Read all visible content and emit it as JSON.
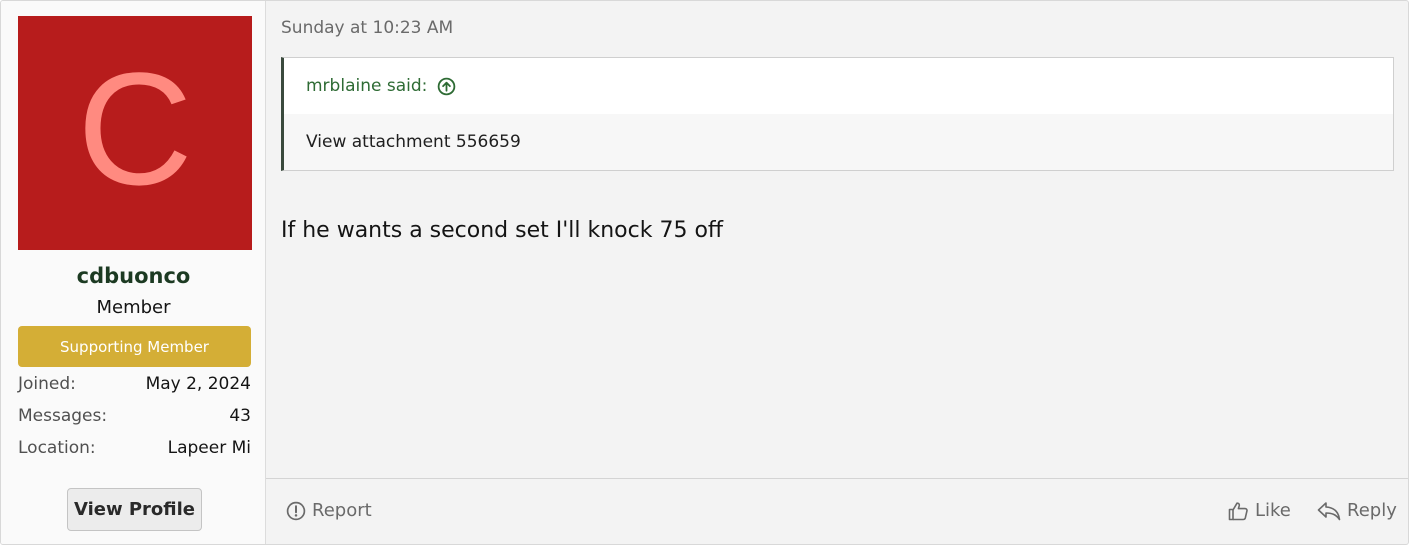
{
  "user": {
    "avatar_letter": "C",
    "avatar_bg": "#b71c1c",
    "avatar_fg": "#ff8a80",
    "name": "cdbuonco",
    "title": "Member",
    "banner": "Supporting Member",
    "banner_color": "#d4ae36",
    "stats": [
      {
        "label": "Joined:",
        "value": "May 2, 2024"
      },
      {
        "label": "Messages:",
        "value": "43"
      },
      {
        "label": "Location:",
        "value": "Lapeer Mi"
      }
    ],
    "view_profile_label": "View Profile"
  },
  "post": {
    "date": "Sunday at 10:23 AM",
    "quote": {
      "author_line": "mrblaine said:",
      "icon": "arrow-circle-up-icon",
      "body": "View attachment 556659"
    },
    "text": "If he wants a second set I'll knock 75 off"
  },
  "actions": {
    "report": "Report",
    "like": "Like",
    "reply": "Reply"
  }
}
